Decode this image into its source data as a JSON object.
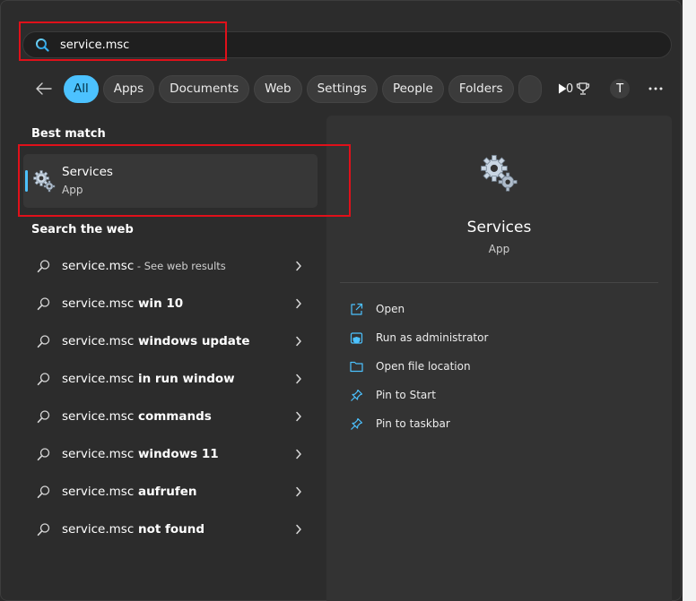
{
  "search": {
    "value": "service.msc"
  },
  "filters": {
    "chips": [
      "All",
      "Apps",
      "Documents",
      "Web",
      "Settings",
      "People",
      "Folders"
    ],
    "points": "0",
    "avatar_initial": "T"
  },
  "best_match": {
    "title": "Best match",
    "name": "Services",
    "type": "App"
  },
  "search_web": {
    "title": "Search the web",
    "items": [
      {
        "query": "service.msc",
        "suffix": "",
        "note": " - See web results"
      },
      {
        "query": "service.msc",
        "suffix": " win 10",
        "note": ""
      },
      {
        "query": "service.msc",
        "suffix": " windows update",
        "note": ""
      },
      {
        "query": "service.msc",
        "suffix": " in run window",
        "note": ""
      },
      {
        "query": "service.msc",
        "suffix": " commands",
        "note": ""
      },
      {
        "query": "service.msc",
        "suffix": " windows 11",
        "note": ""
      },
      {
        "query": "service.msc",
        "suffix": " aufrufen",
        "note": ""
      },
      {
        "query": "service.msc",
        "suffix": " not found",
        "note": ""
      }
    ]
  },
  "detail": {
    "name": "Services",
    "type": "App",
    "actions": [
      "Open",
      "Run as administrator",
      "Open file location",
      "Pin to Start",
      "Pin to taskbar"
    ]
  },
  "colors": {
    "accent": "#4cc2ff",
    "highlight": "#e0101a"
  }
}
